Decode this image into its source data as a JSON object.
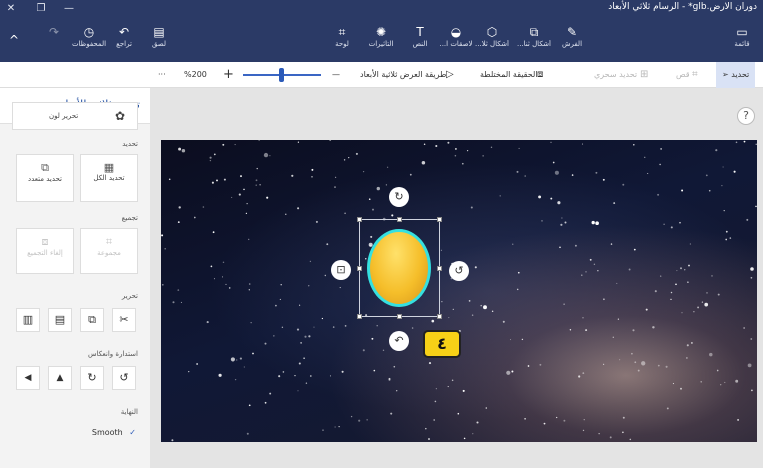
{
  "window": {
    "title": "دوران الارض.glb* - الرسام ثلاثي الأبعاد",
    "close_glyph": "✕",
    "restore_glyph": "❐",
    "minimize_glyph": "—"
  },
  "ribbon": {
    "menu": {
      "label": "قائمة",
      "icon": "folder-icon"
    },
    "brushes": {
      "label": "الفرش",
      "icon": "brush-icon"
    },
    "shapes2d": {
      "label": "أشكال ثنا...",
      "icon": "shapes-2d-icon"
    },
    "shapes3d": {
      "label": "أشكال ثلا...",
      "icon": "cube-icon"
    },
    "stickers": {
      "label": "لاصقات ا...",
      "icon": "sticker-icon"
    },
    "text": {
      "label": "النص",
      "icon": "text-icon"
    },
    "effects": {
      "label": "التأثيرات",
      "icon": "effects-icon"
    },
    "canvas": {
      "label": "لوحة",
      "icon": "canvas-icon"
    },
    "paste": {
      "label": "لصق",
      "icon": "paste-icon"
    },
    "undo": {
      "label": "تراجع",
      "icon": "undo-icon"
    },
    "history": {
      "label": "المحفوظات",
      "icon": "history-icon"
    },
    "redo": {
      "label": "",
      "icon": "redo-icon"
    },
    "collapse_glyph": "^"
  },
  "toolbar": {
    "select": "تحديد",
    "crop": "قص",
    "magic_select": "تحديد سحري",
    "mixed_reality": "الحقيقة المختلطة",
    "view3d": "طريقة العرض ثلاثية الأبعاد",
    "zoom_value": "%200",
    "zoom_minus": "—",
    "zoom_plus": "+",
    "more": "···"
  },
  "panel": {
    "title": "تحديد ثلاثي الأبعاد",
    "edit_color": "تحرير لون",
    "section_select": "تحديد",
    "select_all": "تحديد الكل",
    "multi_select": "تحديد متعدد",
    "section_group": "تجميع",
    "group": "مجموعة",
    "ungroup": "إلغاء التجميع",
    "section_edit": "تحرير",
    "section_rotate": "استدارة وانعكاس",
    "section_finish": "النهاية",
    "smooth": "Smooth",
    "check_glyph": "✓",
    "edit_buttons": [
      {
        "name": "cut-icon",
        "glyph": "✂"
      },
      {
        "name": "copy-icon",
        "glyph": "⧉"
      },
      {
        "name": "paste-icon",
        "glyph": "▤"
      },
      {
        "name": "delete-icon",
        "glyph": "▥"
      }
    ],
    "rotate_buttons": [
      {
        "name": "rotate-left-icon",
        "glyph": "↺"
      },
      {
        "name": "rotate-right-icon",
        "glyph": "↻"
      },
      {
        "name": "flip-vertical-icon",
        "glyph": "▲"
      },
      {
        "name": "flip-horizontal-icon",
        "glyph": "◀"
      }
    ]
  },
  "canvas": {
    "help_glyph": "?",
    "badge": "٤",
    "background_colors": [
      "#0b0d1f",
      "#101836",
      "#171a2e"
    ],
    "object_color": "#f5be2a",
    "outline_color": "#35e0e0"
  }
}
